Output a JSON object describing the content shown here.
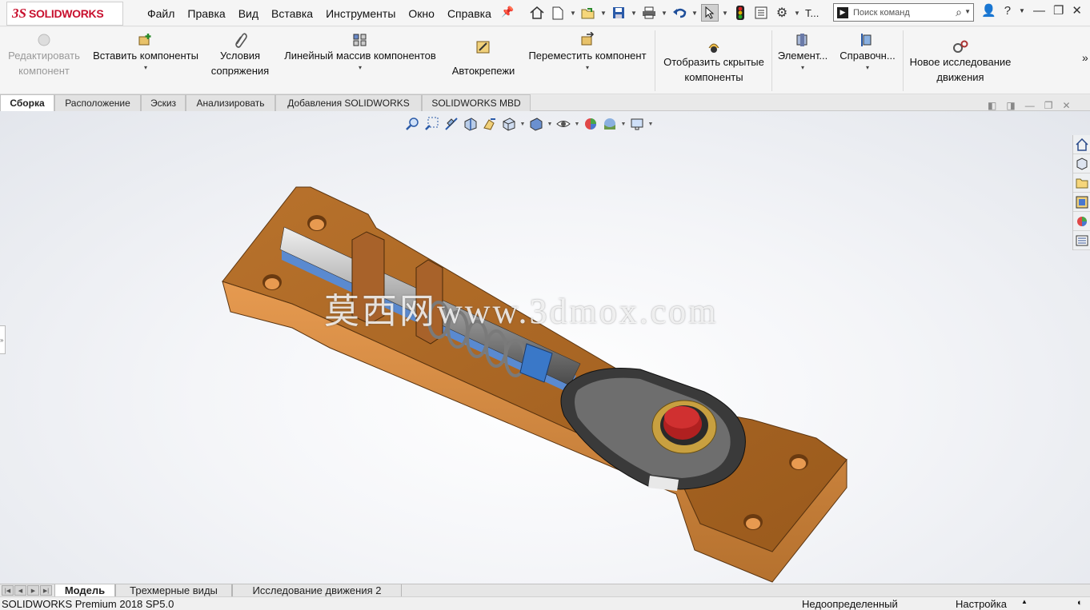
{
  "app": {
    "logo_ds": "3S",
    "logo_text": "SOLIDWORKS",
    "menu": [
      "Файл",
      "Правка",
      "Вид",
      "Вставка",
      "Инструменты",
      "Окно",
      "Справка"
    ],
    "selection_label": "Т...",
    "search_placeholder": "Поиск команд"
  },
  "command_manager": {
    "edit_component": "Редактировать компонент",
    "insert_components": "Вставить компоненты",
    "mate": "Условия сопряжения",
    "linear_pattern": "Линейный массив компонентов",
    "fasteners": "Автокрепежи",
    "move_component": "Переместить компонент",
    "show_hidden": "Отобразить скрытые компоненты",
    "assembly_features": "Элемент...",
    "reference_geometry": "Справочн...",
    "new_motion_study": "Новое исследование движения",
    "more": "»"
  },
  "tabs": [
    "Сборка",
    "Расположение",
    "Эскиз",
    "Анализировать",
    "Добавления SOLIDWORKS",
    "SOLIDWORKS MBD"
  ],
  "active_tab": "Сборка",
  "watermark": "莫西网www.3dmox.com",
  "bottom_tabs": [
    "Модель",
    "Трехмерные виды",
    "Исследование движения 2"
  ],
  "status": {
    "product": "SOLIDWORKS Premium 2018 SP5.0",
    "definition": "Недоопределенный",
    "custom": "Настройка"
  },
  "colors": {
    "brand": "#c8102e",
    "part_body": "#c0772e",
    "accent_blue": "#2a6ad1"
  }
}
